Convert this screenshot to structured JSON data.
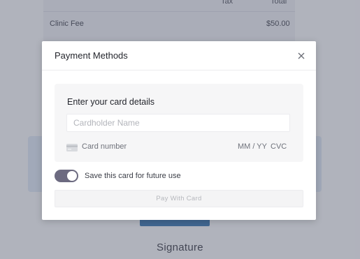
{
  "background": {
    "table": {
      "headers": [
        "Tax",
        "Total"
      ],
      "rows": [
        {
          "label": "Clinic Fee",
          "total": "$50.00"
        }
      ]
    },
    "signature_title": "Signature"
  },
  "modal": {
    "title": "Payment Methods",
    "close_icon": "close-icon",
    "card_section": {
      "title": "Enter your card details",
      "cardholder_placeholder": "Cardholder Name",
      "cardholder_value": "",
      "card_icon": "credit-card-icon",
      "card_number_placeholder": "Card number",
      "expiry_placeholder": "MM / YY",
      "cvc_placeholder": "CVC"
    },
    "save_card": {
      "label": "Save this card for future use",
      "enabled": true
    },
    "pay_button_label": "Pay With Card"
  },
  "colors": {
    "overlay": "#565a6e",
    "toggle_on": "#6c6a80",
    "background_button": "#2e6fab",
    "pay_button_disabled_text": "#b6b8bd"
  }
}
